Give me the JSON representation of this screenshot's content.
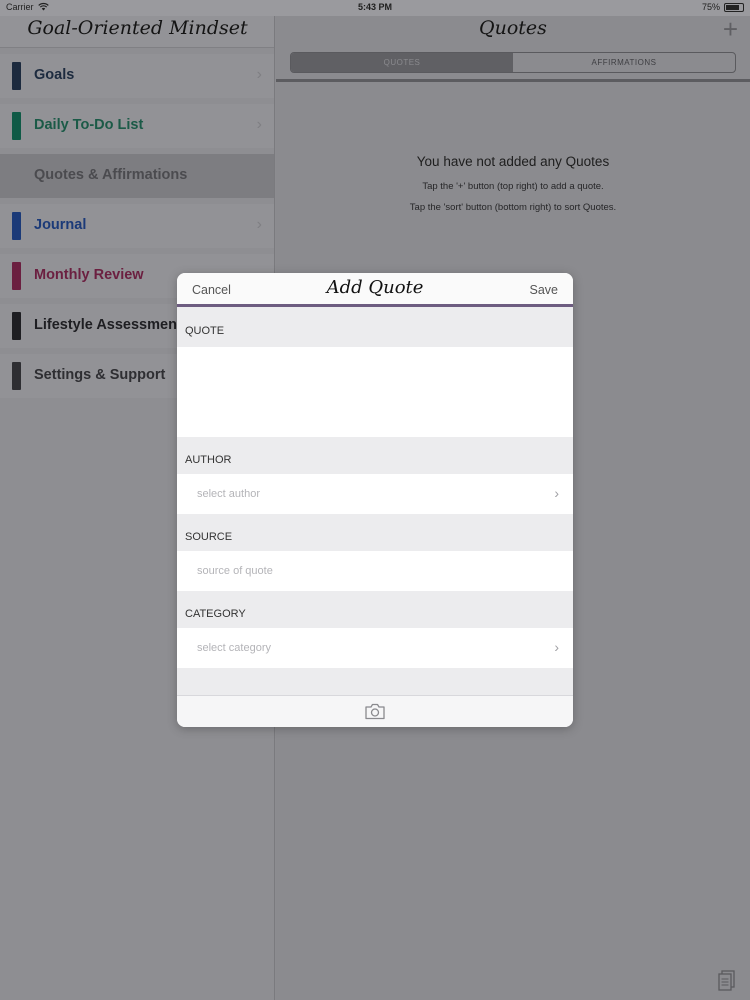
{
  "status_bar": {
    "carrier": "Carrier",
    "time": "5:43 PM",
    "battery": "75%"
  },
  "master": {
    "title": "Goal-Oriented Mindset",
    "items": [
      {
        "label": "Goals",
        "color": "#1c2a3e",
        "text_color": "#1d2b3f",
        "chevron": true
      },
      {
        "label": "Daily To-Do List",
        "color": "#0f5a46",
        "text_color": "#1b5a47",
        "chevron": true
      },
      {
        "label": "Quotes & Affirmations",
        "color": "",
        "text_color": "#4b4b4f",
        "chevron": false
      },
      {
        "label": "Journal",
        "color": "#1b3a78",
        "text_color": "#1b3a78",
        "chevron": true
      },
      {
        "label": "Monthly Review",
        "color": "#6b1f40",
        "text_color": "#6b1f40",
        "chevron": true
      },
      {
        "label": "Lifestyle Assessment",
        "color": "#1e1e22",
        "text_color": "#1e1e22",
        "chevron": true
      },
      {
        "label": "Settings & Support",
        "color": "#2e2e32",
        "text_color": "#2e2e32",
        "chevron": false
      }
    ]
  },
  "detail": {
    "title": "Quotes",
    "plus_icon": "plus",
    "segments": [
      "QUOTES",
      "AFFIRMATIONS"
    ],
    "empty_title": "You have not added any Quotes",
    "empty_line1": "Tap the '+' button (top right) to add a quote.",
    "empty_line2": "Tap the 'sort' button (bottom right) to sort Quotes.",
    "sort_icon": "sort-icon"
  },
  "modal": {
    "title": "Add Quote",
    "cancel": "Cancel",
    "save": "Save",
    "quote_label": "QUOTE",
    "quote_value": "",
    "author_label": "AUTHOR",
    "author_placeholder": "select author",
    "source_label": "SOURCE",
    "source_placeholder": "source of quote",
    "category_label": "CATEGORY",
    "category_placeholder": "select category",
    "camera_icon": "camera-icon",
    "accent": "#6d5c80"
  }
}
